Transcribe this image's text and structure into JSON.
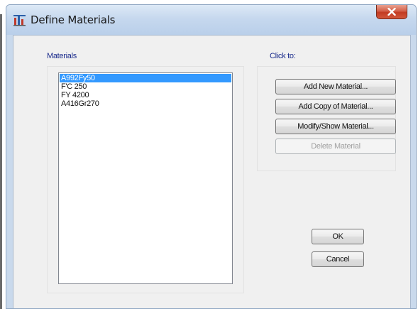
{
  "window": {
    "title": "Define Materials",
    "icon": "structure-app-icon",
    "close_icon": "close-icon"
  },
  "materials": {
    "label": "Materials",
    "items": [
      "A992Fy50",
      "F'C 250",
      "FY 4200",
      "A416Gr270"
    ],
    "selected_index": 0
  },
  "actions": {
    "label": "Click to:",
    "add_new": "Add New Material...",
    "add_copy": "Add Copy of Material...",
    "modify_show": "Modify/Show Material...",
    "delete": "Delete Material"
  },
  "dialog_buttons": {
    "ok": "OK",
    "cancel": "Cancel"
  },
  "colors": {
    "selection": "#3399ff",
    "group_label": "#1a2b8c",
    "close_button": "#c23b22"
  }
}
